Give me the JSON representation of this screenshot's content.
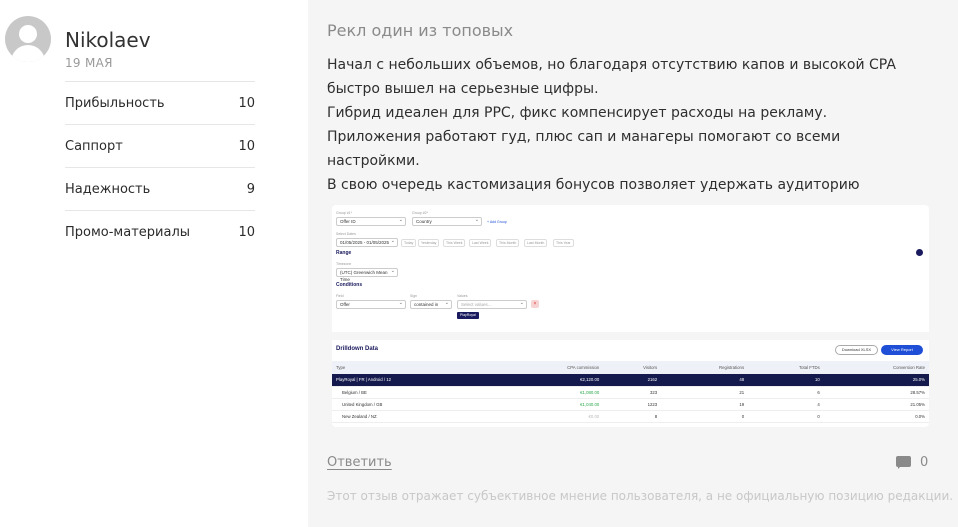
{
  "author": {
    "name": "Nikolaev",
    "date": "19 МАЯ"
  },
  "ratings": [
    {
      "label": "Прибыльность",
      "value": "10"
    },
    {
      "label": "Саппорт",
      "value": "10"
    },
    {
      "label": "Надежность",
      "value": "9"
    },
    {
      "label": "Промо-материалы",
      "value": "10"
    }
  ],
  "review": {
    "title": "Рекл один из топовых",
    "lines": [
      "Начал с небольших объемов, но благодаря отсутствию капов и высокой CPA",
      "быстро вышел на серьезные цифры.",
      "Гибрид идеален для PPC, фикс компенсирует расходы на рекламу.",
      "Приложения работают гуд, плюс сап и манагеры помогают со всеми настройкми.",
      "В свою очередь кастомизация бонусов позволяет удержать аудиторию"
    ]
  },
  "screenshot": {
    "group1_label": "Group #1*",
    "group1_value": "Offer ID",
    "group2_label": "Group #2*",
    "group2_value": "Country",
    "add_group": "+ Add Group",
    "dates_label": "Select Dates",
    "dates_value": "01/05/2025 - 01/05/2025",
    "chips": [
      "Today",
      "Yesterday",
      "This Week",
      "Last Week",
      "This Month",
      "Last Month",
      "This Year"
    ],
    "range_label": "Range",
    "timezone_label": "Timezone",
    "timezone_value": "(UTC) Greenwich Mean Time",
    "conditions_label": "Conditions",
    "field_label": "Field",
    "field_value": "Offer",
    "sign_label": "Sign",
    "sign_value": "contained in",
    "values_label": "Values",
    "values_placeholder": "Select values...",
    "tag_value": "PlayRoyal",
    "drilldown_title": "Drilldown Data",
    "download_label": "Download XLSX",
    "view_report_label": "View Report",
    "columns": [
      "Type",
      "CPA commission",
      "Visitors",
      "Registrations",
      "Total FTDs",
      "Conversion Rate"
    ],
    "rows": [
      {
        "type": "PlayRoyal | FR | Android / 12",
        "cpa": "€2,120.00",
        "visitors": "2162",
        "regs": "48",
        "ftds": "10",
        "conv": "25.0%"
      },
      {
        "type": "Belgium / BE",
        "cpa": "€1,080.00",
        "visitors": "323",
        "regs": "21",
        "ftds": "6",
        "conv": "28.57%"
      },
      {
        "type": "United Kingdom / GB",
        "cpa": "€1,040.00",
        "visitors": "1223",
        "regs": "19",
        "ftds": "4",
        "conv": "21.05%"
      },
      {
        "type": "New Zealand / NZ",
        "cpa": "€0.00",
        "visitors": "8",
        "regs": "0",
        "ftds": "0",
        "conv": "0.0%"
      }
    ]
  },
  "footer": {
    "reply": "Ответить",
    "comment_count": "0",
    "disclaimer": "Этот отзыв отражает субъективное мнение пользователя, а не официальную позицию редакции."
  },
  "icons": {
    "avatar": "user-silhouette-icon",
    "comments": "speech-bubble-icon"
  }
}
